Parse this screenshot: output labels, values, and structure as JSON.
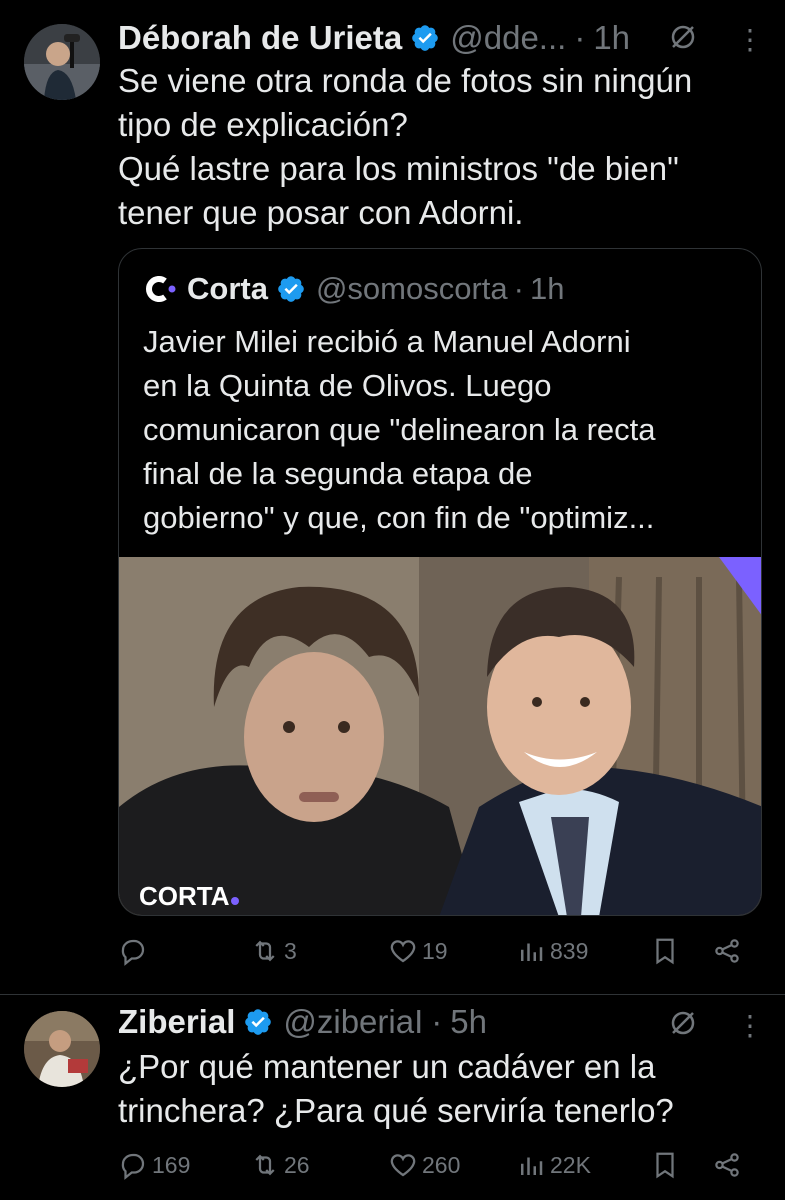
{
  "tweet1": {
    "name": "Déborah de Urieta",
    "handle": "@dde...",
    "sep": "·",
    "time": "1h",
    "more": "⋮",
    "text": "Se viene otra ronda de fotos sin ningún\ntipo de explicación?\nQué lastre para los ministros \"de bien\"\ntener que posar con Adorni.",
    "quote": {
      "name": "Corta",
      "handle": "@somoscorta",
      "sep": "·",
      "time": "1h",
      "text": "Javier Milei recibió a Manuel Adorni\nen la Quinta de Olivos. Luego\ncomunicaron que \"delinearon la recta\nfinal de la segunda etapa de\ngobierno\" y que, con fin de \"optimiz...",
      "watermark": "CORTA"
    },
    "actions": {
      "replies": "",
      "reposts": "3",
      "likes": "19",
      "views": "839"
    }
  },
  "tweet2": {
    "name": "Ziberial",
    "handle": "@ziberiaI",
    "sep": "·",
    "time": "5h",
    "more": "⋮",
    "text": "¿Por qué mantener un cadáver en la\ntrinchera? ¿Para qué serviría tenerlo?",
    "actions": {
      "replies": "169",
      "reposts": "26",
      "likes": "260",
      "views": "22K"
    }
  },
  "colors": {
    "background": "#000000",
    "text": "#e7e9ea",
    "muted": "#71767b",
    "verified": "#1d9bf0",
    "border": "#2f3336",
    "brand_accent": "#7b61ff"
  },
  "icons": [
    "verified-badge-icon",
    "grok-icon",
    "more-icon",
    "reply-icon",
    "repost-icon",
    "like-icon",
    "views-icon",
    "bookmark-icon",
    "share-icon",
    "corta-logo-icon"
  ]
}
